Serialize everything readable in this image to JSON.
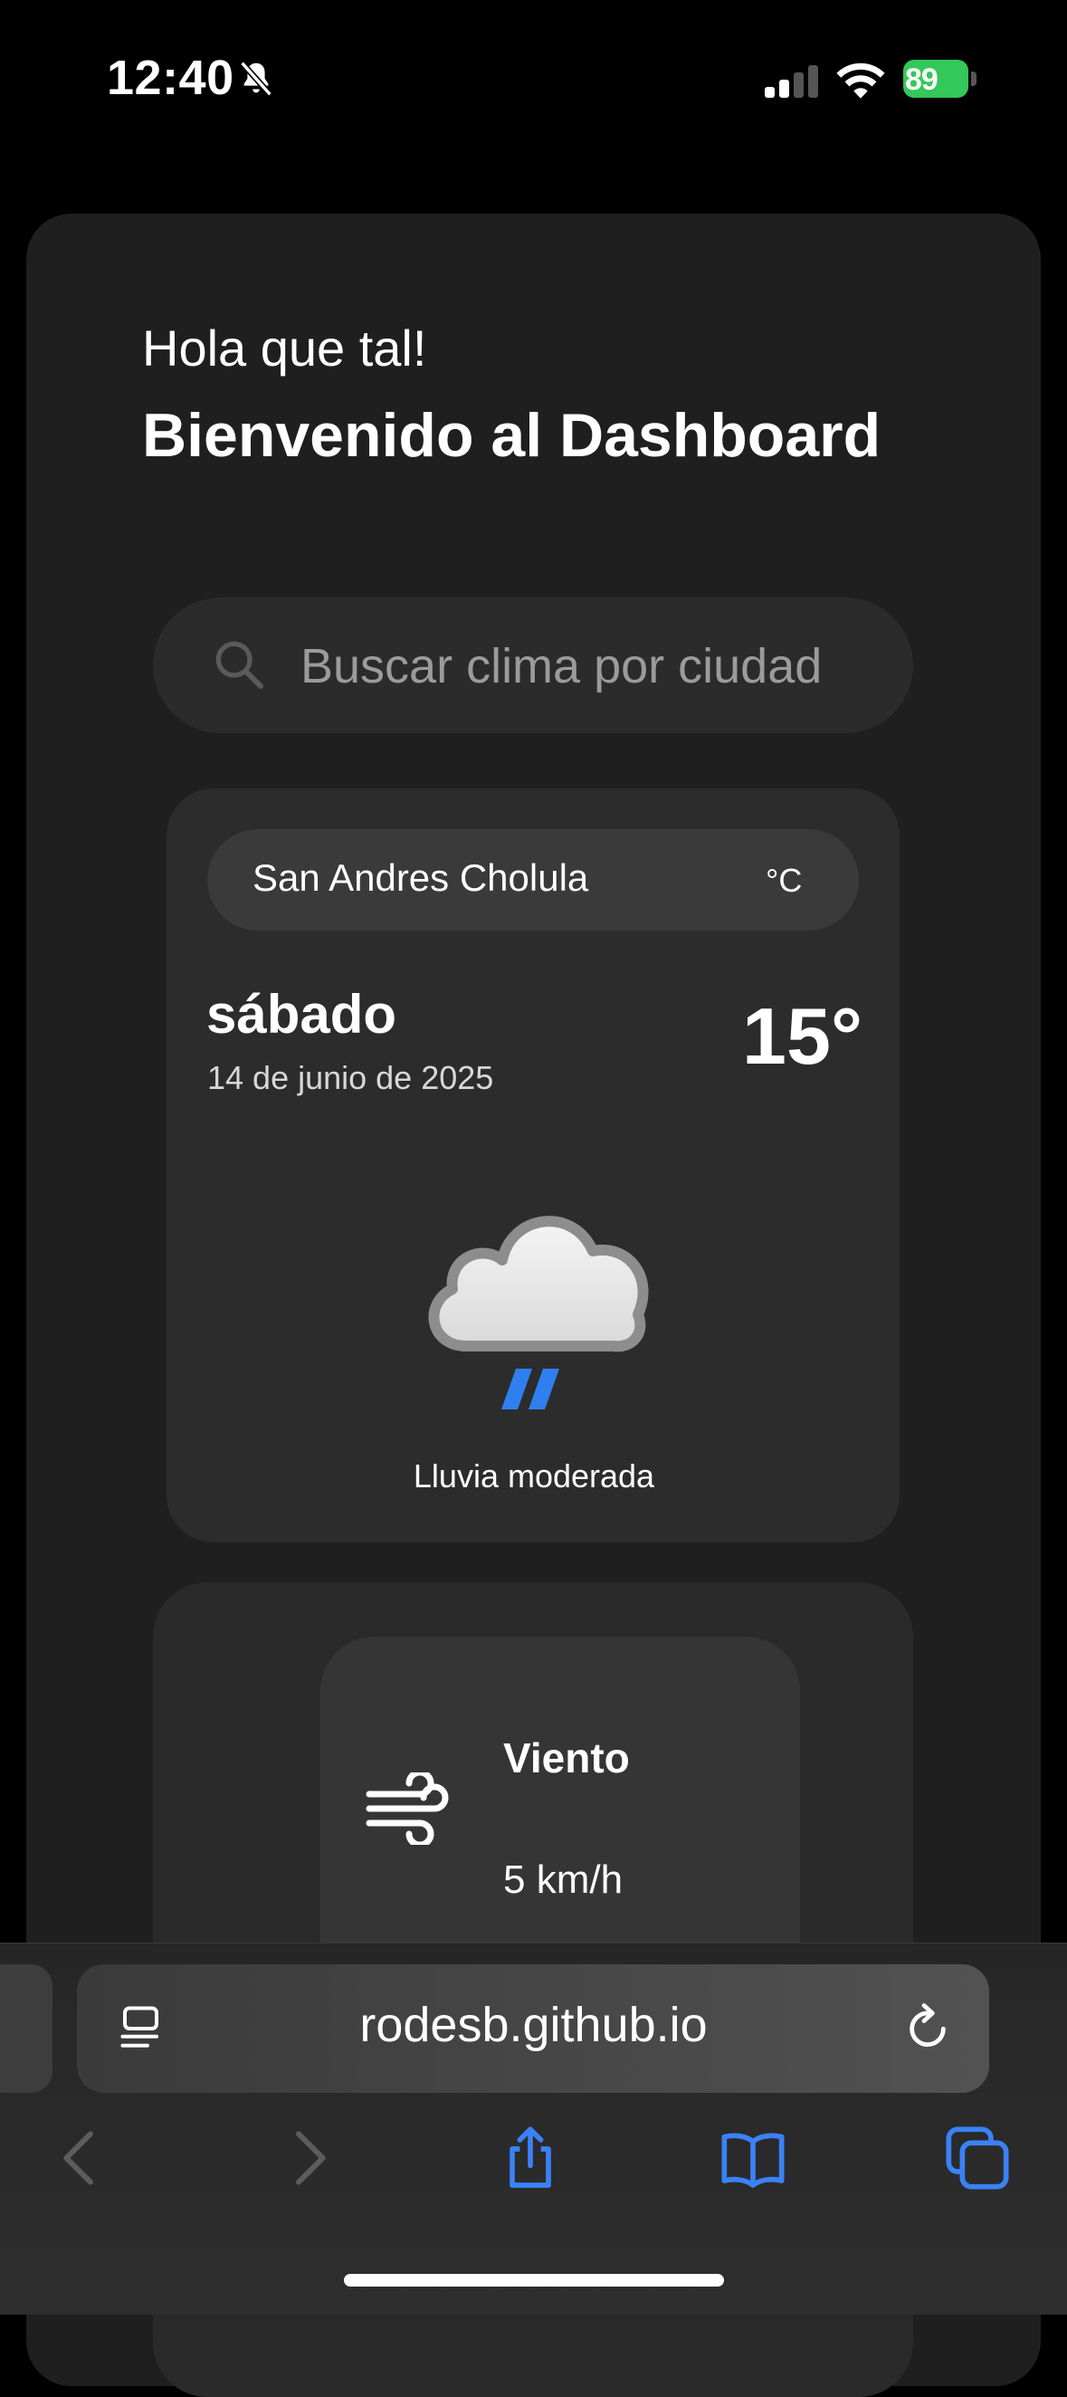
{
  "status_bar": {
    "time": "12:40",
    "battery_percent": "89"
  },
  "header": {
    "greeting": "Hola que tal!",
    "title": "Bienvenido al Dashboard"
  },
  "search": {
    "placeholder": "Buscar clima por ciudad",
    "value": ""
  },
  "weather": {
    "city": "San Andres Cholula",
    "unit": "°C",
    "day": "sábado",
    "date": "14 de junio de 2025",
    "temperature": "15°",
    "condition": "Lluvia moderada",
    "icon": "rain-cloud-icon"
  },
  "details": {
    "wind_label": "Viento",
    "wind_value": "5 km/h"
  },
  "browser": {
    "url": "rodesb.github.io",
    "accent_color": "#3a82f7"
  }
}
